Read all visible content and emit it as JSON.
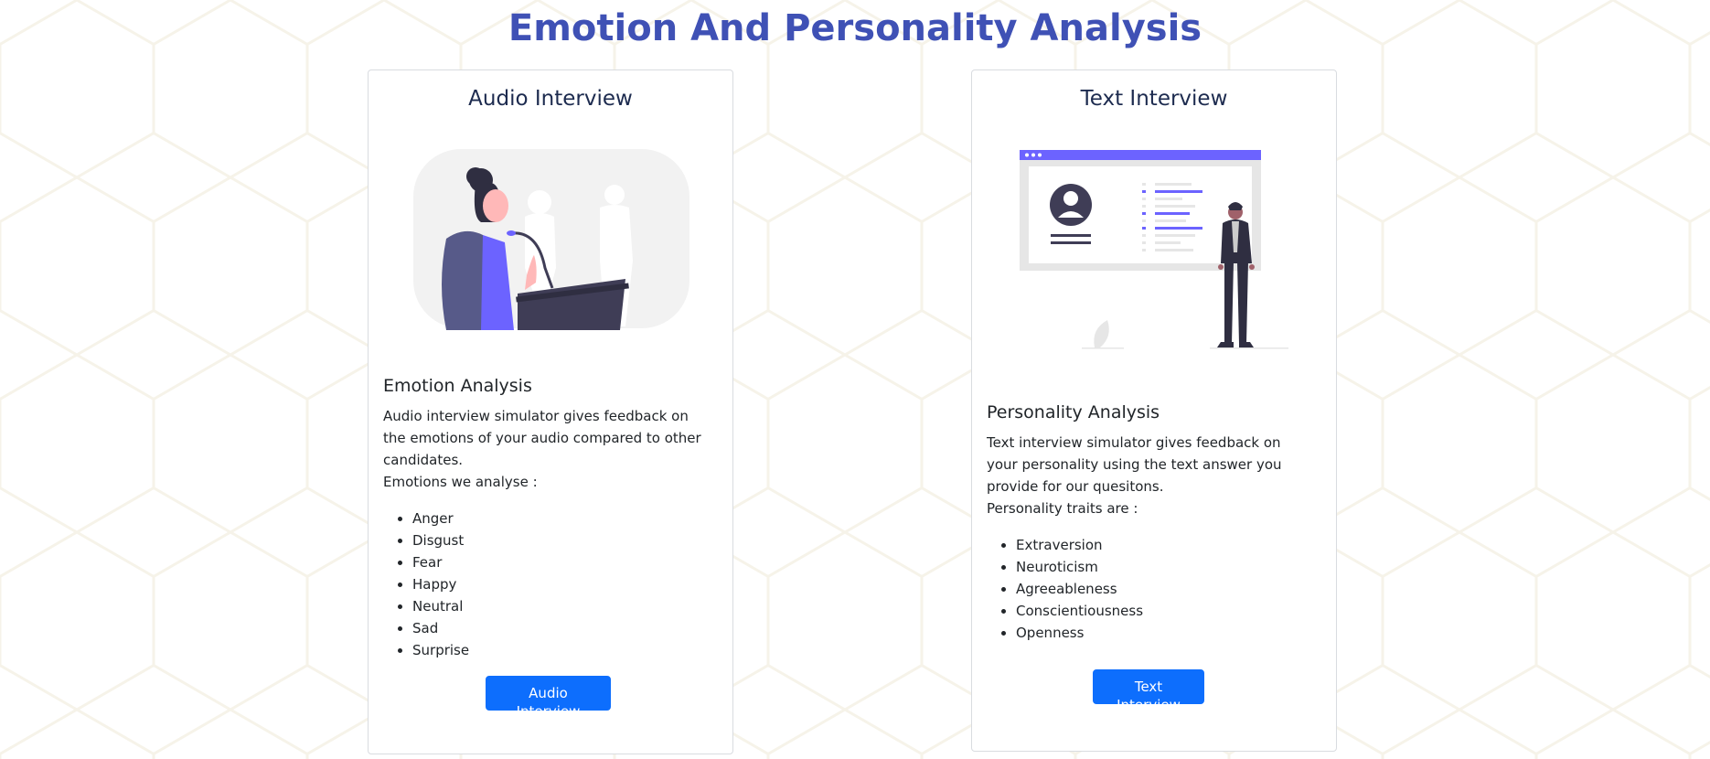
{
  "page": {
    "title": "Emotion And Personality Analysis",
    "colors": {
      "title": "#3f51b5",
      "button": "#0d6efd",
      "illustration_accent": "#6c63ff"
    }
  },
  "audio_card": {
    "title": "Audio Interview",
    "illustration": "woman-speaking-at-podium-illustration",
    "section_title": "Emotion Analysis",
    "description": [
      "Audio interview simulator gives feedback on the emotions of your audio compared to other candidates.",
      "Emotions we analyse :"
    ],
    "items": [
      "Anger",
      "Disgust",
      "Fear",
      "Happy",
      "Neutral",
      "Sad",
      "Surprise"
    ],
    "button_label": "Audio Interview"
  },
  "text_card": {
    "title": "Text Interview",
    "illustration": "man-presenting-profile-screen-illustration",
    "section_title": "Personality Analysis",
    "description": [
      "Text interview simulator gives feedback on your personality using the text answer you provide for our quesitons.",
      "Personality traits are :"
    ],
    "items": [
      "Extraversion",
      "Neuroticism",
      "Agreeableness",
      "Conscientiousness",
      "Openness"
    ],
    "button_label": "Text Interview"
  }
}
